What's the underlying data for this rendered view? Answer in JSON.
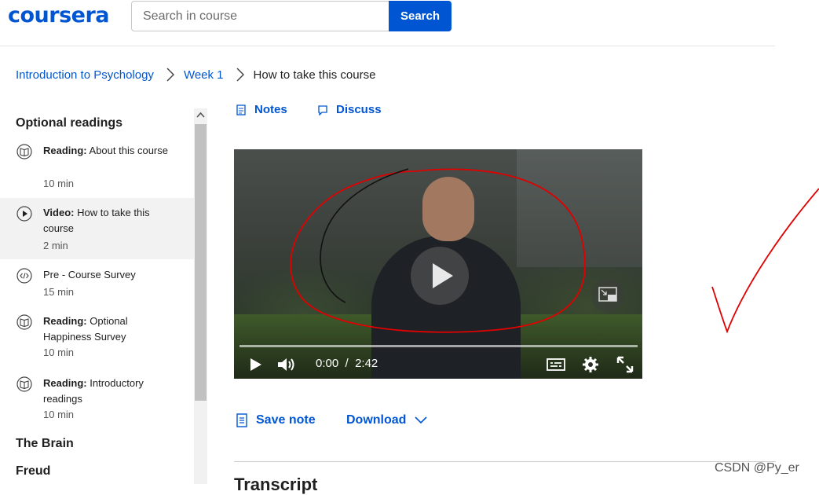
{
  "header": {
    "logo_text": "coursera",
    "search": {
      "placeholder": "Search in course",
      "value": "",
      "button_label": "Search"
    }
  },
  "breadcrumb": [
    "Introduction to Psychology",
    "Week 1",
    "How to take this course"
  ],
  "sidebar": {
    "sections": [
      {
        "title": "Optional readings",
        "items": [
          {
            "type": "Reading:",
            "title": "About this course",
            "duration": "10 min",
            "icon": "book-icon"
          },
          {
            "type": "Video:",
            "title": "How to take this course",
            "duration": "2 min",
            "icon": "play-icon",
            "active": true
          },
          {
            "type": "",
            "title": "Pre - Course Survey",
            "duration": "15 min",
            "icon": "code-icon"
          },
          {
            "type": "Reading:",
            "title": "Optional Happiness Survey",
            "duration": "10 min",
            "icon": "book-icon"
          },
          {
            "type": "Reading:",
            "title": "Introductory readings",
            "duration": "10 min",
            "icon": "book-icon"
          }
        ]
      },
      {
        "title": "The Brain"
      },
      {
        "title": "Freud"
      }
    ]
  },
  "tabs": {
    "notes": "Notes",
    "discuss": "Discuss"
  },
  "player": {
    "current_time": "0:00",
    "separator": "/",
    "duration": "2:42",
    "progress": 0
  },
  "actions": {
    "save_note": "Save note",
    "download": "Download"
  },
  "transcript_heading": "Transcript",
  "watermark": "CSDN @Py_er",
  "colors": {
    "brand": "#0056d2",
    "annotation": "#e00000"
  }
}
